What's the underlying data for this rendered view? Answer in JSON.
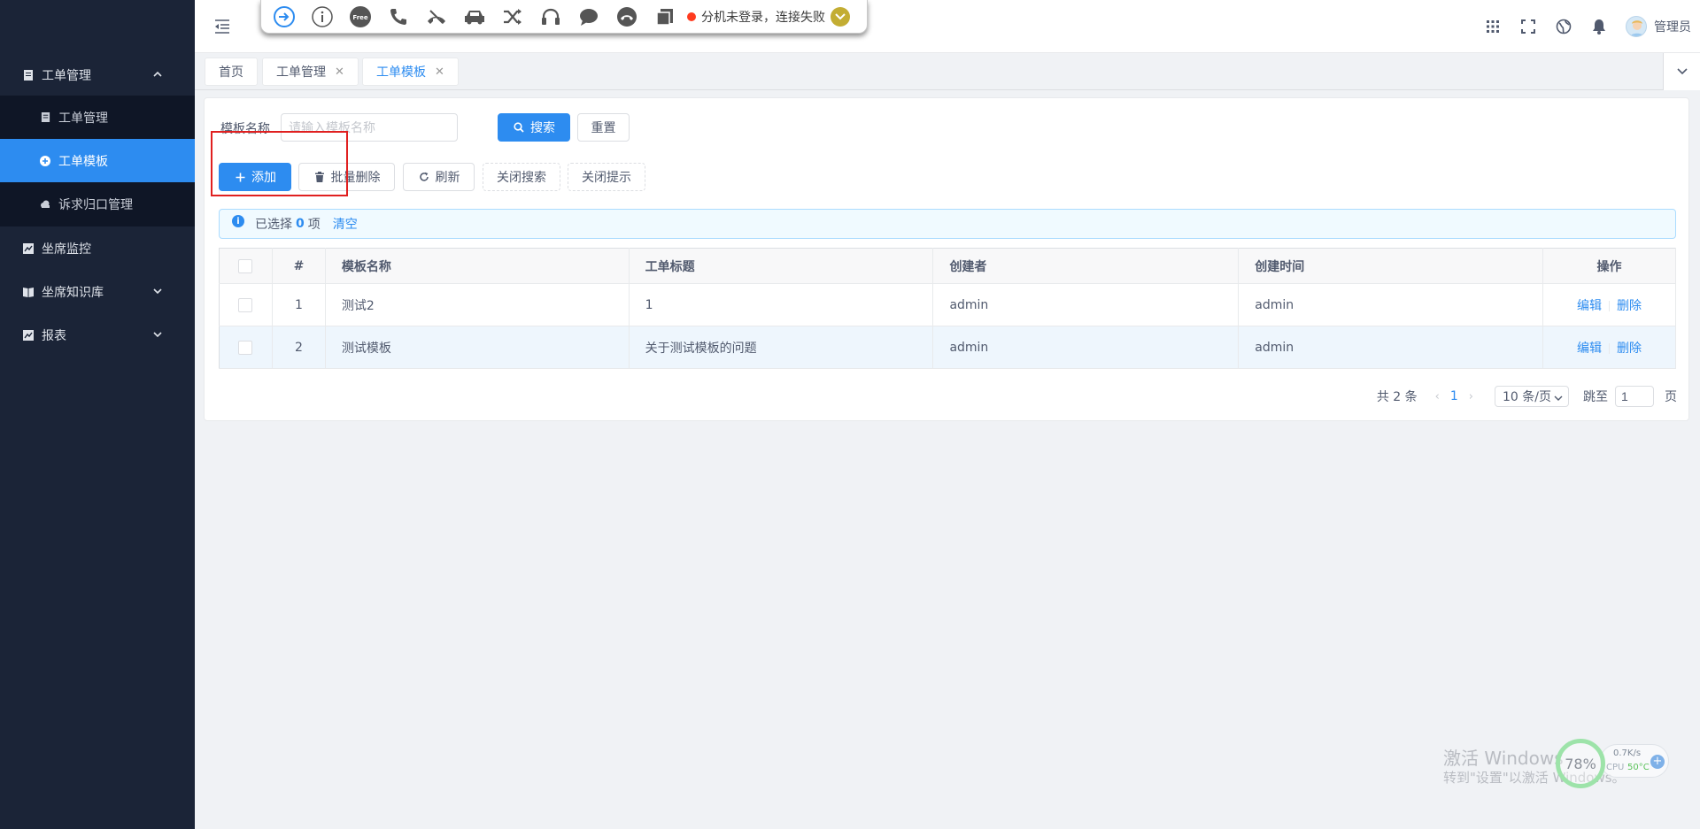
{
  "sidebar": {
    "items": [
      {
        "label": "工单管理",
        "expanded": true
      },
      {
        "label": "工单管理"
      },
      {
        "label": "工单模板",
        "active": true
      },
      {
        "label": "诉求归口管理"
      },
      {
        "label": "坐席监控"
      },
      {
        "label": "坐席知识库"
      },
      {
        "label": "报表"
      }
    ]
  },
  "phonebar": {
    "icons": [
      "login-icon",
      "info-icon",
      "free-icon",
      "phone-icon",
      "hangup-icon",
      "car-icon",
      "shuffle-icon",
      "headset-icon",
      "chat-icon",
      "end-call-icon",
      "copy-icon"
    ],
    "free_badge": "Free",
    "status_text": "分机未登录，连接失败",
    "status_color": "#ff3b1f"
  },
  "header": {
    "username": "管理员"
  },
  "tabs": [
    {
      "label": "首页"
    },
    {
      "label": "工单管理"
    },
    {
      "label": "工单模板",
      "active": true
    }
  ],
  "search": {
    "label": "模板名称",
    "placeholder": "请输入模板名称",
    "search_btn": "搜索",
    "reset_btn": "重置"
  },
  "toolbar": {
    "add": "添加",
    "batch_delete": "批量删除",
    "refresh": "刷新",
    "close_search": "关闭搜索",
    "close_tip": "关闭提示"
  },
  "alert": {
    "prefix": "已选择",
    "count": "0",
    "suffix": "项",
    "clear": "清空"
  },
  "table": {
    "headers": [
      "#",
      "模板名称",
      "工单标题",
      "创建者",
      "创建时间",
      "操作"
    ],
    "rows": [
      {
        "index": "1",
        "name": "测试2",
        "title": "1",
        "creator": "admin",
        "created": "admin"
      },
      {
        "index": "2",
        "name": "测试模板",
        "title": "关于测试模板的问题",
        "creator": "admin",
        "created": "admin"
      }
    ],
    "edit": "编辑",
    "delete": "删除"
  },
  "pagination": {
    "total": "共 2 条",
    "current": "1",
    "page_size": "10 条/页",
    "jump_label": "跳至",
    "jump_value": "1",
    "page_suffix": "页"
  },
  "watermark": {
    "line1": "激活 Windows",
    "line2": "转到\"设置\"以激活 Windows。"
  },
  "widget": {
    "percent": "78%",
    "net": "0.7K/s",
    "cpu_label": "CPU",
    "cpu_temp": "50°C"
  },
  "colors": {
    "primary": "#2d8cf0",
    "sidebar_bg": "#1b2437",
    "highlight_box": "#e02020"
  }
}
